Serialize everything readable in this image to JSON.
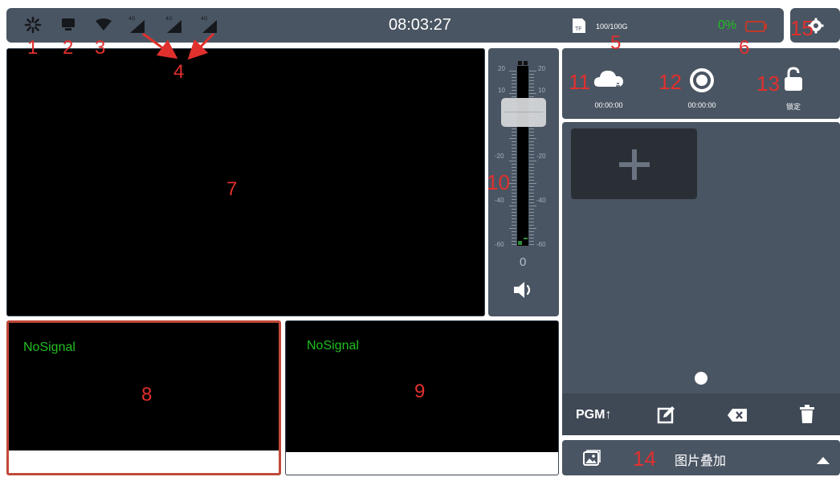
{
  "status_bar": {
    "time": "08:03:27",
    "storage": "100/100G",
    "storage_tag": "TF",
    "battery": "0%",
    "signal_labels": [
      "4G",
      "4G",
      "4G"
    ]
  },
  "annotations": {
    "n1": "1",
    "n2": "2",
    "n3": "3",
    "n4": "4",
    "n5": "5",
    "n6": "6",
    "n7": "7",
    "n8": "8",
    "n9": "9",
    "n10": "10",
    "n11": "11",
    "n12": "12",
    "n13": "13",
    "n14": "14",
    "n15": "15"
  },
  "audio_meter": {
    "value": "0",
    "scale_left": [
      "20",
      "10",
      "-20",
      "-40",
      "-60"
    ],
    "scale_right": [
      "20",
      "10",
      "-20",
      "-40",
      "-60"
    ]
  },
  "controls": {
    "stream_time": "00:00:00",
    "record_time": "00:00:00",
    "lock_label": "锁定"
  },
  "sources": [
    {
      "status": "NoSignal"
    },
    {
      "status": "NoSignal"
    }
  ],
  "toolbar": {
    "pgm_label": "PGM↑"
  },
  "overlay": {
    "label": "图片叠加"
  },
  "colors": {
    "panel": "#4a5563",
    "accent_red": "#e0302d",
    "signal_green": "#1fc01f",
    "selected_border": "#c0493a"
  }
}
